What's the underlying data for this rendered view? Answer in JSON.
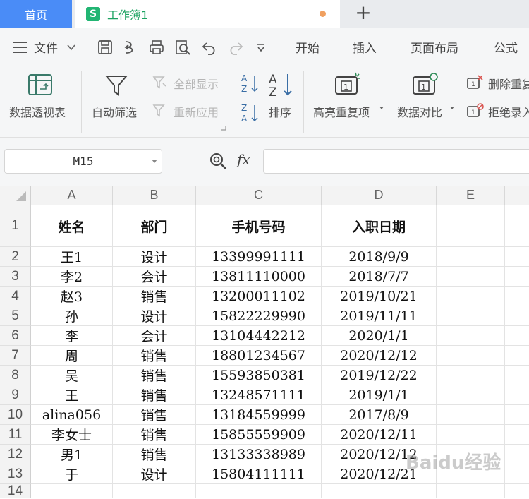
{
  "tabs": {
    "home": "首页",
    "document": "工作簿1",
    "doc_icon": "S"
  },
  "menu": {
    "file": "文件",
    "items": [
      "开始",
      "插入",
      "页面布局",
      "公式"
    ]
  },
  "ribbon": {
    "pivot": "数据透视表",
    "autofilter": "自动筛选",
    "show_all": "全部显示",
    "reapply": "重新应用",
    "sort": "排序",
    "highlight_dup": "高亮重复项",
    "data_compare": "数据对比",
    "delete_dup": "删除重复项",
    "reject_entry": "拒绝录入"
  },
  "formula": {
    "name_box": "M15",
    "fx": "fx",
    "value": ""
  },
  "columns": [
    "A",
    "B",
    "C",
    "D",
    "E"
  ],
  "rows": [
    {
      "num": "1",
      "cells": [
        "姓名",
        "部门",
        "手机号码",
        "入职日期"
      ],
      "header": true
    },
    {
      "num": "2",
      "cells": [
        "王1",
        "设计",
        "13399991111",
        "2018/9/9"
      ]
    },
    {
      "num": "3",
      "cells": [
        "李2",
        "会计",
        "13811110000",
        "2018/7/7"
      ]
    },
    {
      "num": "4",
      "cells": [
        "赵3",
        "销售",
        "13200011102",
        "2019/10/21"
      ]
    },
    {
      "num": "5",
      "cells": [
        "孙",
        "设计",
        "15822229990",
        "2019/11/11"
      ]
    },
    {
      "num": "6",
      "cells": [
        "李",
        "会计",
        "13104442212",
        "2020/1/1"
      ]
    },
    {
      "num": "7",
      "cells": [
        "周",
        "销售",
        "18801234567",
        "2020/12/12"
      ]
    },
    {
      "num": "8",
      "cells": [
        "吴",
        "销售",
        "15593850381",
        "2019/12/22"
      ]
    },
    {
      "num": "9",
      "cells": [
        "王",
        "销售",
        "13248571111",
        "2019/1/1"
      ]
    },
    {
      "num": "10",
      "cells": [
        "alina056",
        "销售",
        "13184559999",
        "2017/8/9"
      ]
    },
    {
      "num": "11",
      "cells": [
        "李女士",
        "销售",
        "15855559909",
        "2020/12/11"
      ]
    },
    {
      "num": "12",
      "cells": [
        "男1",
        "销售",
        "13133338989",
        "2020/12/12"
      ]
    },
    {
      "num": "13",
      "cells": [
        "于",
        "设计",
        "15804111111",
        "2020/12/21"
      ]
    },
    {
      "num": "14",
      "cells": [
        "",
        "",
        "",
        ""
      ]
    }
  ],
  "watermark": "Baidu经验"
}
